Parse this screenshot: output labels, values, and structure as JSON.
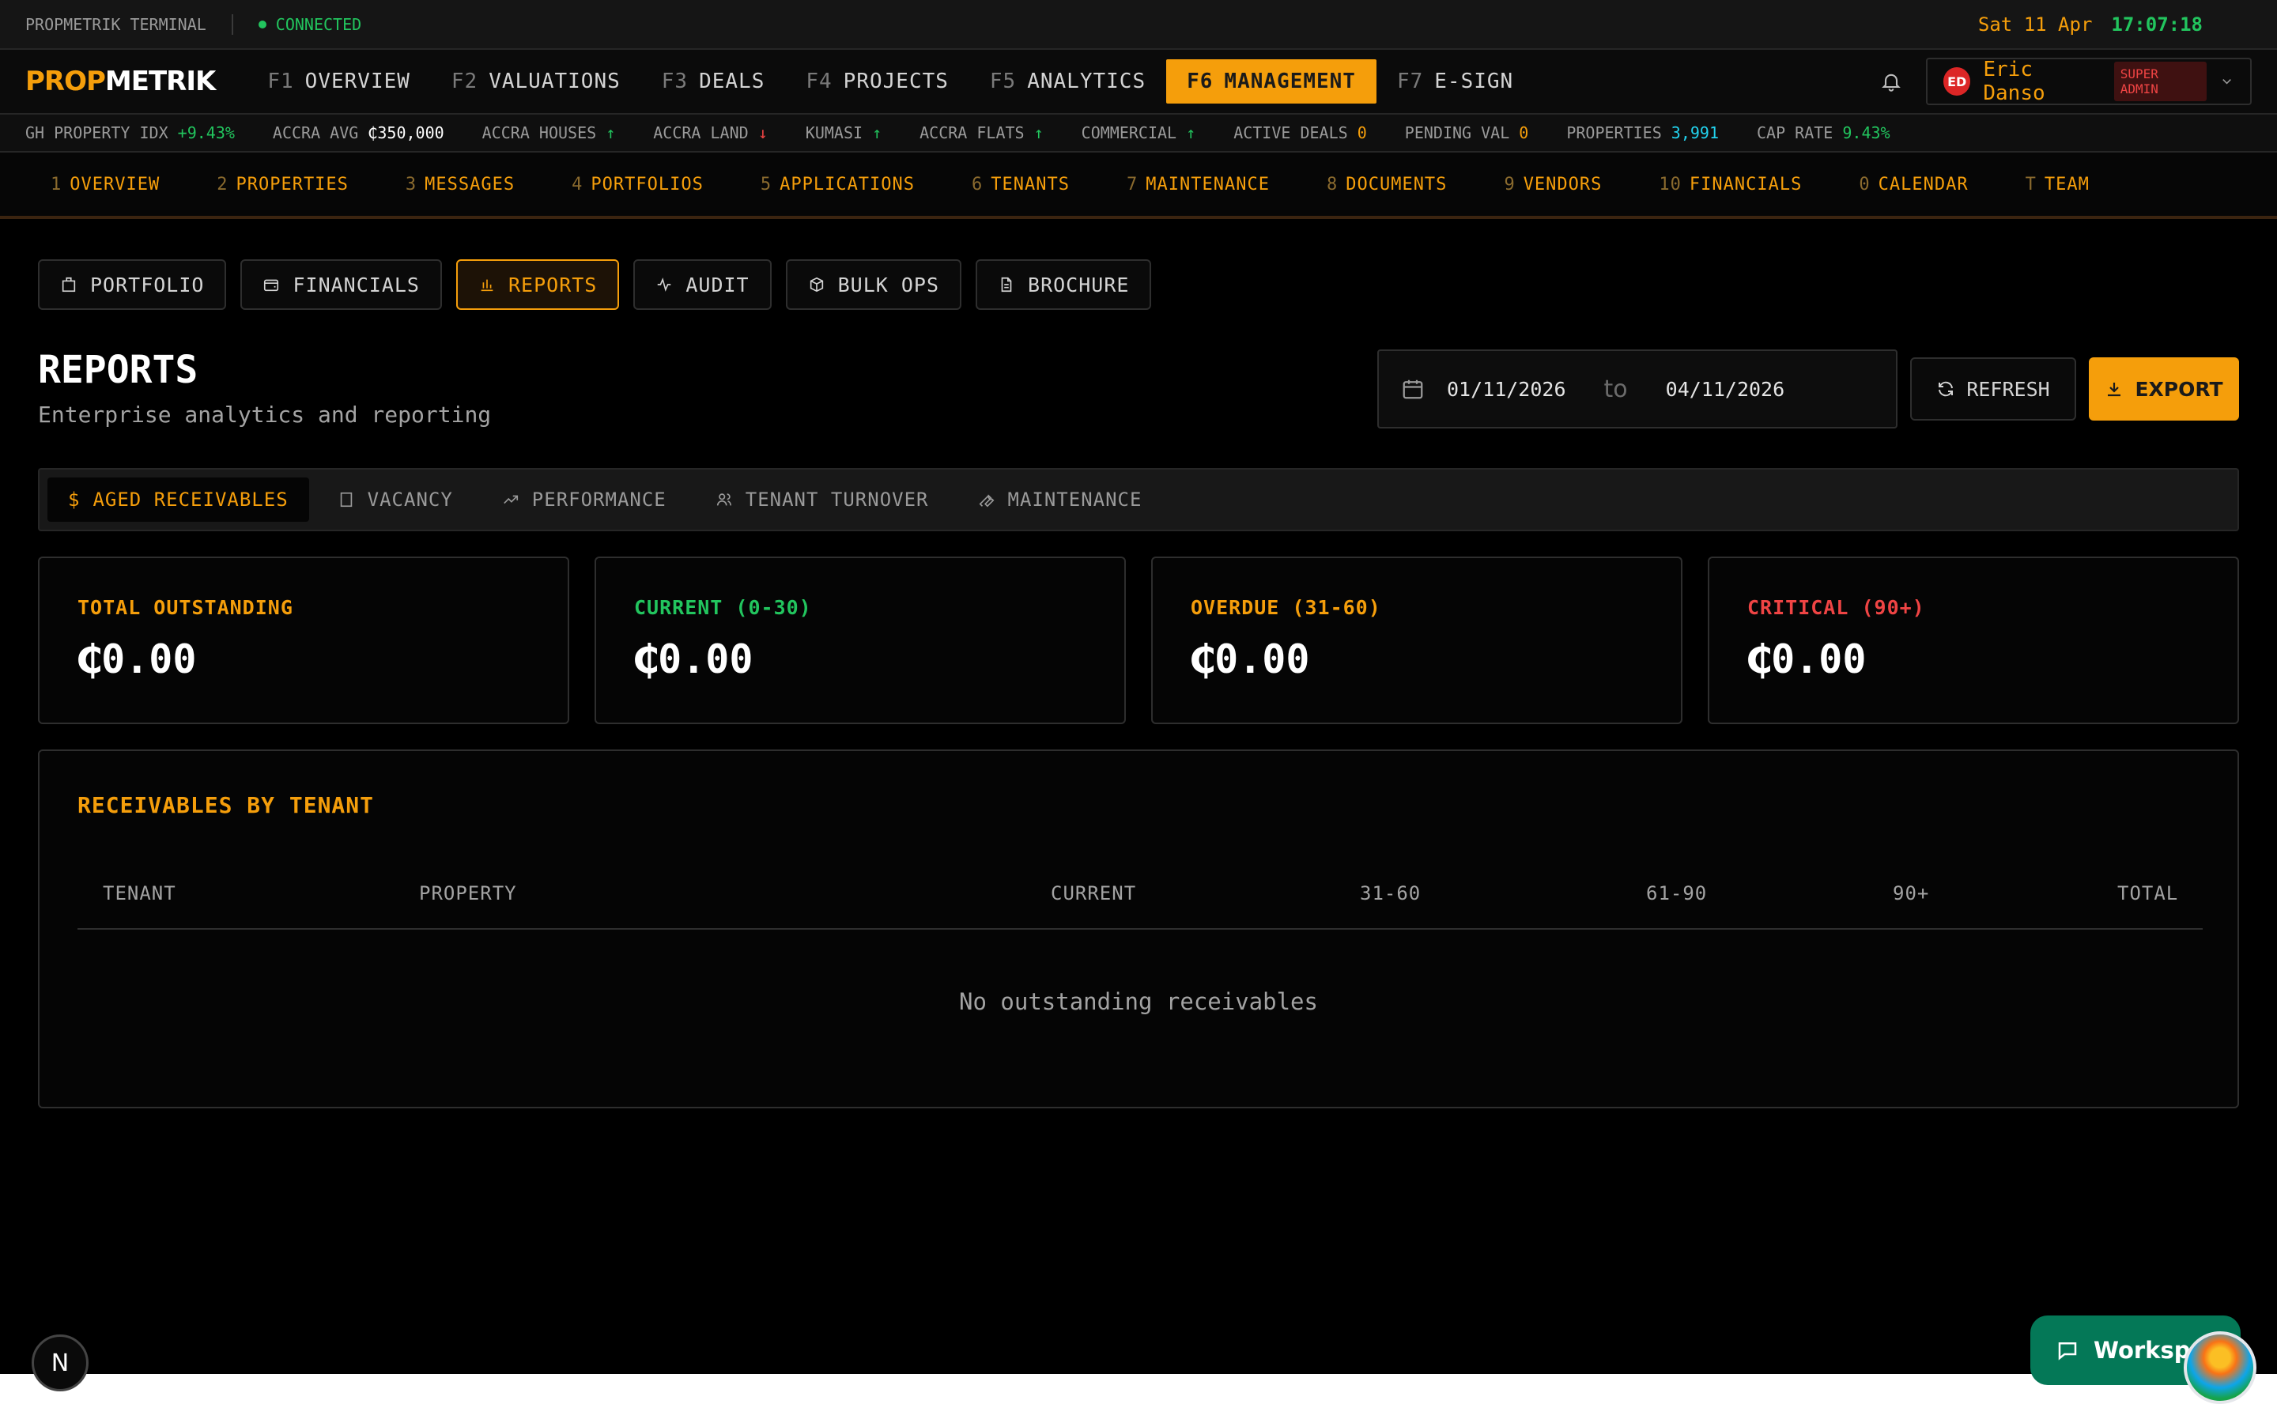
{
  "topbar": {
    "terminal": "PROPMETRIK TERMINAL",
    "status": "CONNECTED",
    "date": "Sat 11 Apr",
    "time": "17:07:18"
  },
  "logo": {
    "part1": "PROP",
    "part2": "METRIK"
  },
  "main_nav": [
    {
      "key": "F1",
      "label": "OVERVIEW"
    },
    {
      "key": "F2",
      "label": "VALUATIONS"
    },
    {
      "key": "F3",
      "label": "DEALS"
    },
    {
      "key": "F4",
      "label": "PROJECTS"
    },
    {
      "key": "F5",
      "label": "ANALYTICS"
    },
    {
      "key": "F6",
      "label": "MANAGEMENT"
    },
    {
      "key": "F7",
      "label": "E-SIGN"
    }
  ],
  "user": {
    "initials": "ED",
    "name": "Eric Danso",
    "role": "SUPER ADMIN"
  },
  "ticker": [
    {
      "label": "GH PROPERTY IDX",
      "value": "+9.43%"
    },
    {
      "label": "ACCRA AVG",
      "value": "₵350,000"
    },
    {
      "label": "ACCRA HOUSES",
      "value": "↑"
    },
    {
      "label": "ACCRA LAND",
      "value": "↓"
    },
    {
      "label": "KUMASI",
      "value": "↑"
    },
    {
      "label": "ACCRA FLATS",
      "value": "↑"
    },
    {
      "label": "COMMERCIAL",
      "value": "↑"
    },
    {
      "label": "ACTIVE DEALS",
      "value": "0"
    },
    {
      "label": "PENDING VAL",
      "value": "0"
    },
    {
      "label": "PROPERTIES",
      "value": "3,991"
    },
    {
      "label": "CAP RATE",
      "value": "9.43%"
    }
  ],
  "sub_nav": [
    {
      "key": "1",
      "label": "OVERVIEW"
    },
    {
      "key": "2",
      "label": "PROPERTIES"
    },
    {
      "key": "3",
      "label": "MESSAGES"
    },
    {
      "key": "4",
      "label": "PORTFOLIOS"
    },
    {
      "key": "5",
      "label": "APPLICATIONS"
    },
    {
      "key": "6",
      "label": "TENANTS"
    },
    {
      "key": "7",
      "label": "MAINTENANCE"
    },
    {
      "key": "8",
      "label": "DOCUMENTS"
    },
    {
      "key": "9",
      "label": "VENDORS"
    },
    {
      "key": "10",
      "label": "FINANCIALS"
    },
    {
      "key": "0",
      "label": "CALENDAR"
    },
    {
      "key": "T",
      "label": "TEAM"
    }
  ],
  "tabs": [
    "PORTFOLIO",
    "FINANCIALS",
    "REPORTS",
    "AUDIT",
    "BULK OPS",
    "BROCHURE"
  ],
  "page": {
    "title": "REPORTS",
    "subtitle": "Enterprise analytics and reporting"
  },
  "date_range": {
    "from": "01/11/2026",
    "to_label": "to",
    "to": "04/11/2026"
  },
  "actions": {
    "refresh": "REFRESH",
    "export": "EXPORT"
  },
  "report_tabs": [
    "AGED RECEIVABLES",
    "VACANCY",
    "PERFORMANCE",
    "TENANT TURNOVER",
    "MAINTENANCE"
  ],
  "cards": [
    {
      "label": "TOTAL OUTSTANDING",
      "value": "₵0.00",
      "color": "#f59e0b"
    },
    {
      "label": "CURRENT (0-30)",
      "value": "₵0.00",
      "color": "#22c55e"
    },
    {
      "label": "OVERDUE (31-60)",
      "value": "₵0.00",
      "color": "#f59e0b"
    },
    {
      "label": "CRITICAL (90+)",
      "value": "₵0.00",
      "color": "#ef4444"
    }
  ],
  "receivables": {
    "title": "RECEIVABLES BY TENANT",
    "columns": [
      "TENANT",
      "PROPERTY",
      "CURRENT",
      "31-60",
      "61-90",
      "90+",
      "TOTAL"
    ],
    "empty": "No outstanding receivables"
  },
  "widgets": {
    "workspace": "Workspace",
    "n_icon": "N"
  },
  "colors": {
    "accent": "#f59e0b",
    "positive": "#22c55e",
    "negative": "#ef4444",
    "info": "#22d3ee"
  }
}
